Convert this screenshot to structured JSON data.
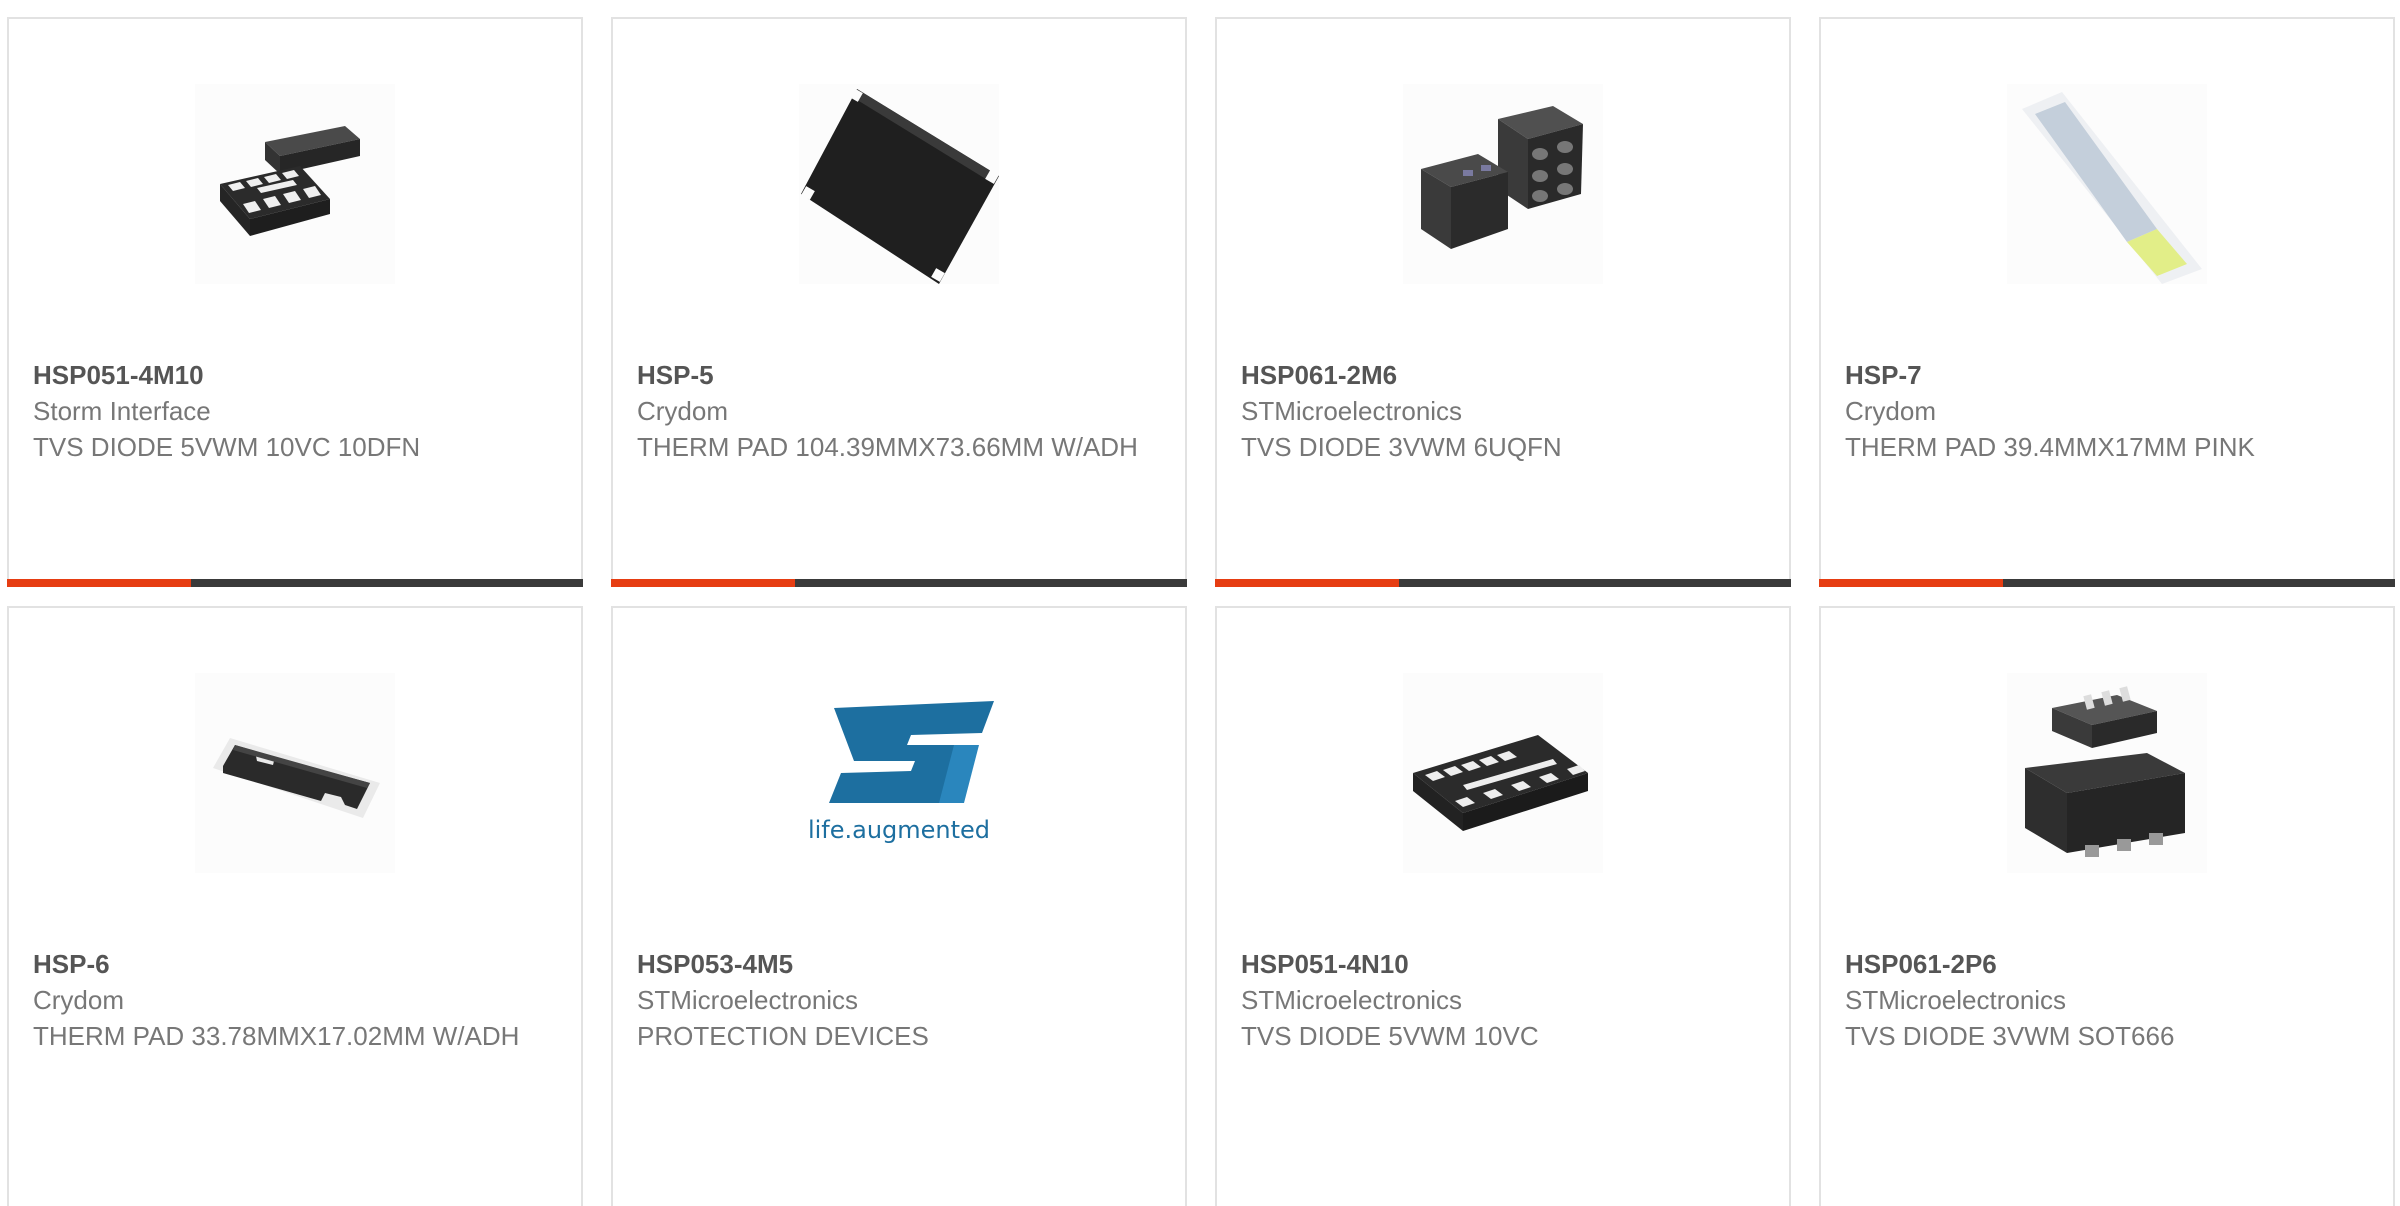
{
  "colors": {
    "accent": "#e63d12",
    "bar_dark": "#3a3a3a",
    "card_border": "#e2e2e2"
  },
  "products": [
    {
      "part_number": "HSP051-4M10",
      "manufacturer": "Storm Interface",
      "description": "TVS DIODE 5VWM 10VC 10DFN",
      "image": "dfn10-chip"
    },
    {
      "part_number": "HSP-5",
      "manufacturer": "Crydom",
      "description": "THERM PAD 104.39MMX73.66MM W/ADH",
      "image": "thermal-pad-black"
    },
    {
      "part_number": "HSP061-2M6",
      "manufacturer": "STMicroelectronics",
      "description": "TVS DIODE 3VWM 6UQFN",
      "image": "uqfn6-chip"
    },
    {
      "part_number": "HSP-7",
      "manufacturer": "Crydom",
      "description": "THERM PAD 39.4MMX17MM PINK",
      "image": "thermal-pad-strip"
    },
    {
      "part_number": "HSP-6",
      "manufacturer": "Crydom",
      "description": "THERM PAD 33.78MMX17.02MM W/ADH",
      "image": "thermal-pad-small"
    },
    {
      "part_number": "HSP053-4M5",
      "manufacturer": "STMicroelectronics",
      "description": "PROTECTION DEVICES",
      "image": "st-logo",
      "logo_tagline": "life.augmented"
    },
    {
      "part_number": "HSP051-4N10",
      "manufacturer": "STMicroelectronics",
      "description": "TVS DIODE 5VWM 10VC",
      "image": "dfn10-chip-top"
    },
    {
      "part_number": "HSP061-2P6",
      "manufacturer": "STMicroelectronics",
      "description": "TVS DIODE 3VWM SOT666",
      "image": "sot666-chip"
    }
  ]
}
